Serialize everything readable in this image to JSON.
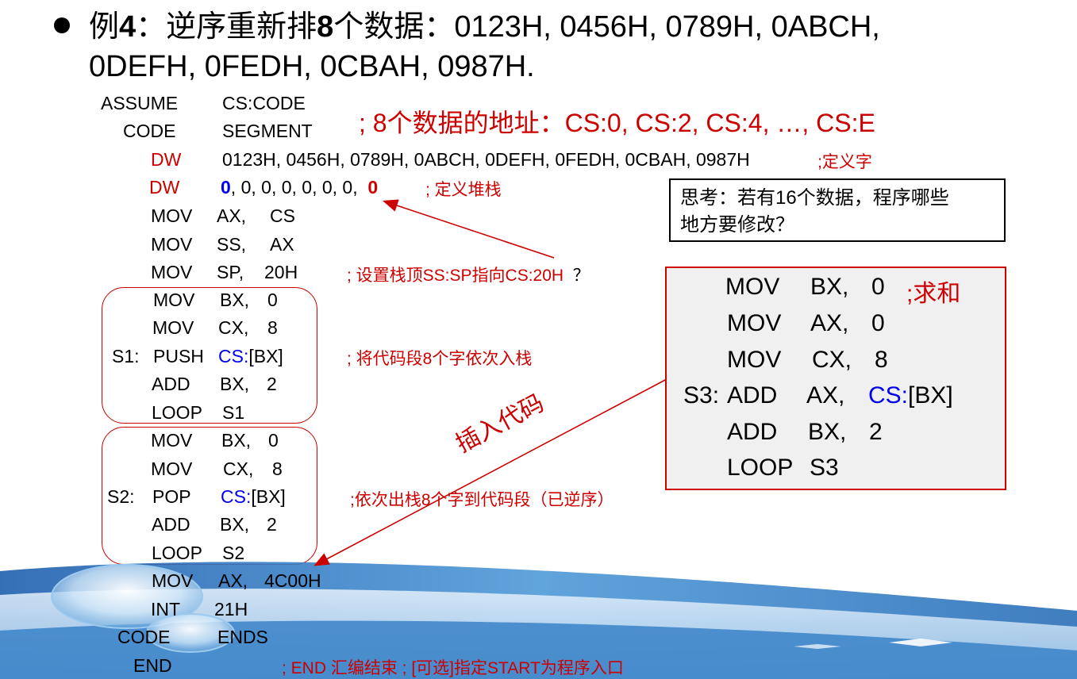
{
  "title": {
    "line1_prefix": "例",
    "line1_num": "4",
    "line1_middle": "：逆序重新排",
    "line1_num2": "8",
    "line1_rest": "个数据：0123H, 0456H, 0789H, 0ABCH,",
    "line2": "0DEFH, 0FEDH, 0CBAH, 0987H."
  },
  "program": {
    "assume": "ASSUME",
    "assume_arg": "CS:CODE",
    "code_seg": "CODE",
    "segment": "SEGMENT",
    "addr_comment": "; 8个数据的地址：CS:0, CS:2, CS:4, …, CS:E",
    "dw1_kw": "DW",
    "dw1_args": "0123H, 0456H, 0789H, 0ABCH, 0DEFH, 0FEDH, 0CBAH, 0987H",
    "dw1_comment": ";定义字",
    "dw2_kw": "DW",
    "dw2_first": "0",
    "dw2_mid": ", 0, 0, 0, 0, 0, 0,",
    "dw2_last": "0",
    "dw2_comment": "; 定义堆栈",
    "l_mov_ax_cs": [
      "MOV",
      "AX,",
      "CS"
    ],
    "l_mov_ss_ax": [
      "MOV",
      "SS,",
      "AX"
    ],
    "l_mov_sp": [
      "MOV",
      "SP,",
      "20H"
    ],
    "sp_comment_pre": "; 设置栈顶",
    "sp_comment_mid": "SS:SP",
    "sp_comment_mid2": "指向",
    "sp_comment_cs": "CS:20H",
    "sp_comment_q": "？",
    "loop1": {
      "l1": [
        "MOV",
        "BX,",
        "0"
      ],
      "l2": [
        "MOV",
        "CX,",
        "8"
      ],
      "label": "S1:",
      "push": "PUSH",
      "cs": "CS:",
      "bx": "[BX]",
      "l4": [
        "ADD",
        "BX,",
        "2"
      ],
      "l5": [
        "LOOP",
        "S1"
      ],
      "comment_pre": "; 将代码段",
      "comment_num": "8",
      "comment_post": "个字依次入栈"
    },
    "loop2": {
      "l1": [
        "MOV",
        "BX,",
        "0"
      ],
      "l2": [
        "MOV",
        "CX,",
        "8"
      ],
      "label": "S2:",
      "pop": "POP",
      "cs": "CS:",
      "bx": "[BX]",
      "l4": [
        "ADD",
        "BX,",
        "2"
      ],
      "l5": [
        "LOOP",
        "S2"
      ],
      "comment_pre": ";依次出栈",
      "comment_num": "8",
      "comment_post": "个字到代码段（已逆序）"
    },
    "l_mov_ax_4c": [
      "MOV",
      "AX,",
      "4C00H"
    ],
    "l_int": [
      "INT",
      "21H"
    ],
    "code_ends": [
      "CODE",
      "ENDS"
    ],
    "end_kw": "END",
    "end_comment": "; END 汇编结束   ; [可选]指定START为程序入口"
  },
  "think_box": {
    "line1": "思考：若有16个数据，程序哪些",
    "line2": "地方要修改？"
  },
  "sum_box": {
    "r1": [
      "MOV",
      "BX,",
      "0"
    ],
    "r1_comment": ";求和",
    "r2": [
      "MOV",
      "AX,",
      "0"
    ],
    "r3": [
      "MOV",
      "CX,",
      "8"
    ],
    "r4_label": "S3:",
    "r4": [
      "ADD",
      "AX,"
    ],
    "r4_cs": "CS:",
    "r4_bx": "[BX]",
    "r5": [
      "ADD",
      "BX,",
      "2"
    ],
    "r6": [
      "LOOP",
      "S3"
    ]
  },
  "insert_label": "插入代码",
  "colors": {
    "red": "#cc0000",
    "blue": "#0000ee",
    "wave_blue": "#2a6fb8"
  }
}
